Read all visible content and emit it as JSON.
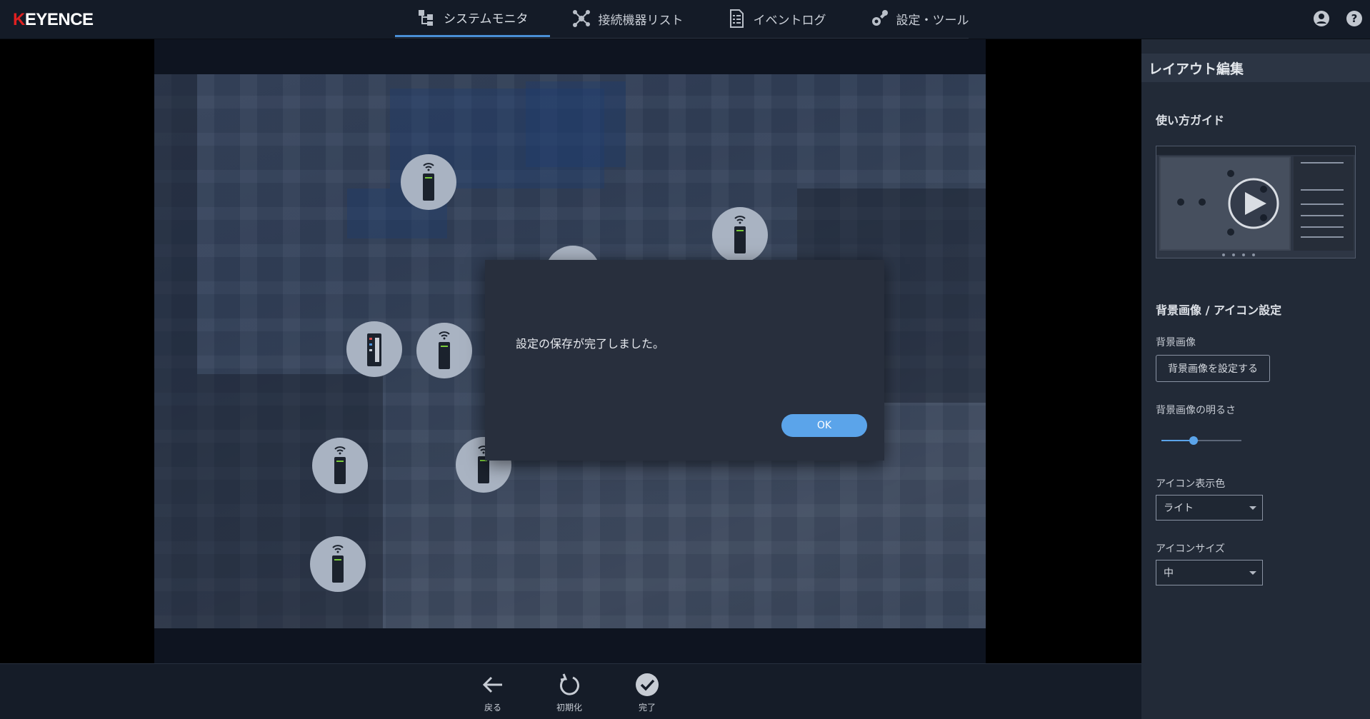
{
  "brand": {
    "logo_text": "EYENCE",
    "logo_mark": "K"
  },
  "nav": {
    "tabs": [
      {
        "label": "システムモニタ",
        "icon": "system-monitor-icon",
        "active": true
      },
      {
        "label": "接続機器リスト",
        "icon": "network-icon"
      },
      {
        "label": "イベントログ",
        "icon": "event-log-icon"
      },
      {
        "label": "設定・ツール",
        "icon": "settings-tools-icon"
      }
    ]
  },
  "modal": {
    "message": "設定の保存が完了しました。",
    "ok_label": "OK"
  },
  "bottom": {
    "back_label": "戻る",
    "reset_label": "初期化",
    "done_label": "完了"
  },
  "panel": {
    "title": "レイアウト編集",
    "guide_heading": "使い方ガイド",
    "bg_section": "背景画像 / アイコン設定",
    "bg_image_label": "背景画像",
    "bg_image_button": "背景画像を設定する",
    "brightness_label": "背景画像の明るさ",
    "brightness_value": 0.4,
    "icon_color_label": "アイコン表示色",
    "icon_color_value": "ライト",
    "icon_size_label": "アイコンサイズ",
    "icon_size_value": "中"
  },
  "colors": {
    "accent": "#5ba4ea",
    "modal_bg": "#282f3d",
    "panel_bg": "#222a37",
    "topbar_bg": "#141b27"
  }
}
